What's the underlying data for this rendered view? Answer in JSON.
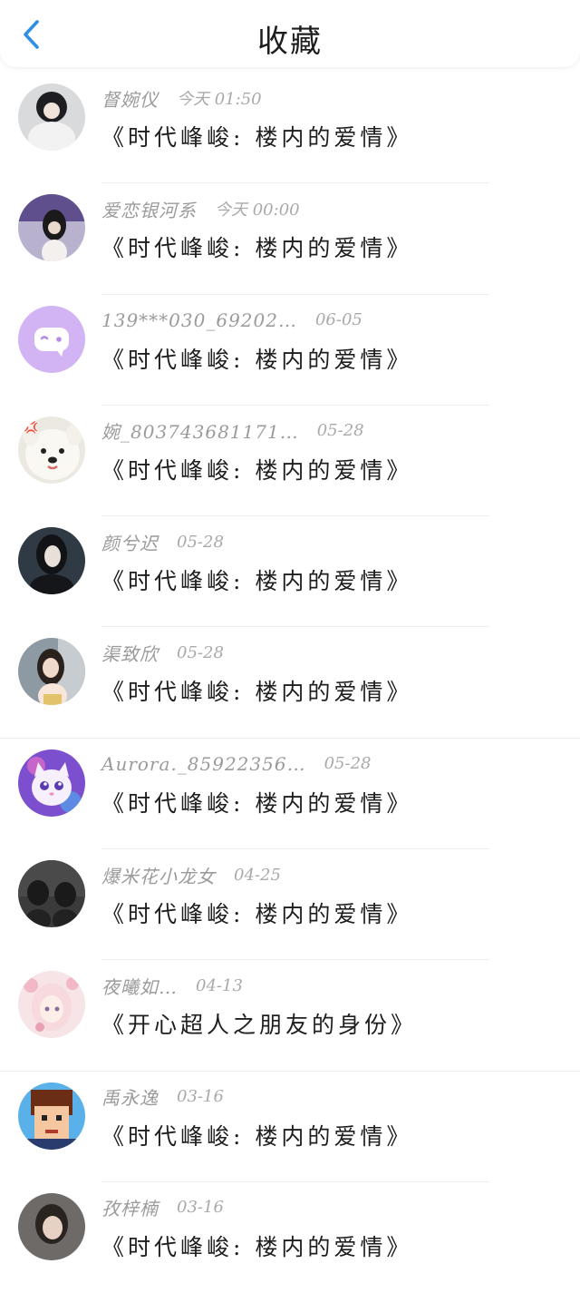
{
  "header": {
    "title": "收藏"
  },
  "icons": {
    "back": "chevron-left-icon"
  },
  "colors": {
    "accent": "#2f8fe8",
    "name_text": "#9b9b9b",
    "title_text": "#1e1e1e"
  },
  "items": [
    {
      "name": "督婉仪",
      "time": "今天 01:50",
      "title": "《时代峰峻: 楼内的爱情》"
    },
    {
      "name": "爱恋银河系",
      "time": "今天 00:00",
      "title": "《时代峰峻: 楼内的爱情》"
    },
    {
      "name": "139***030_69202…",
      "time": "06-05",
      "title": "《时代峰峻: 楼内的爱情》"
    },
    {
      "name": "婉_803743681171…",
      "time": "05-28",
      "title": "《时代峰峻: 楼内的爱情》"
    },
    {
      "name": "颜兮迟",
      "time": "05-28",
      "title": "《时代峰峻: 楼内的爱情》"
    },
    {
      "name": "渠致欣",
      "time": "05-28",
      "title": "《时代峰峻: 楼内的爱情》"
    },
    {
      "name": "Aurora._85922356…",
      "time": "05-28",
      "title": "《时代峰峻: 楼内的爱情》"
    },
    {
      "name": "爆米花小龙女",
      "time": "04-25",
      "title": "《时代峰峻: 楼内的爱情》"
    },
    {
      "name": "夜曦如…",
      "time": "04-13",
      "title": "《开心超人之朋友的身份》"
    },
    {
      "name": "禹永逸",
      "time": "03-16",
      "title": "《时代峰峻: 楼内的爱情》"
    },
    {
      "name": "孜梓楠",
      "time": "03-16",
      "title": "《时代峰峻: 楼内的爱情》"
    }
  ]
}
